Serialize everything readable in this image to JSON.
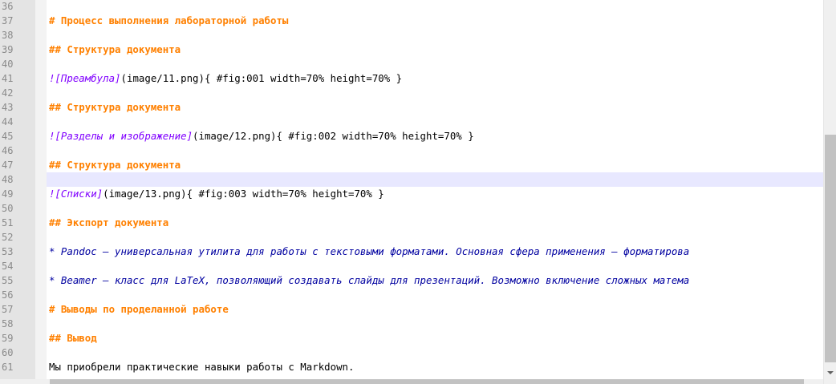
{
  "editor": {
    "lines": [
      {
        "num": "36",
        "segments": []
      },
      {
        "num": "37",
        "segments": [
          {
            "cls": "hdr",
            "text": "# Процесс выполнения лабораторной работы"
          }
        ]
      },
      {
        "num": "38",
        "segments": []
      },
      {
        "num": "39",
        "segments": [
          {
            "cls": "hdr",
            "text": "## Структура документа"
          }
        ]
      },
      {
        "num": "40",
        "segments": []
      },
      {
        "num": "41",
        "segments": [
          {
            "cls": "img-bang",
            "text": "![Преамбула]"
          },
          {
            "cls": "plain",
            "text": "(image/11.png){ #fig:001 width=70% height=70% }"
          }
        ]
      },
      {
        "num": "42",
        "segments": []
      },
      {
        "num": "43",
        "segments": [
          {
            "cls": "hdr",
            "text": "## Структура документа"
          }
        ]
      },
      {
        "num": "44",
        "segments": []
      },
      {
        "num": "45",
        "segments": [
          {
            "cls": "img-bang",
            "text": "![Разделы и изображение]"
          },
          {
            "cls": "plain",
            "text": "(image/12.png){ #fig:002 width=70% height=70% }"
          }
        ]
      },
      {
        "num": "46",
        "segments": []
      },
      {
        "num": "47",
        "segments": [
          {
            "cls": "hdr",
            "text": "## Структура документа"
          }
        ]
      },
      {
        "num": "48",
        "segments": [],
        "current": true
      },
      {
        "num": "49",
        "segments": [
          {
            "cls": "img-bang",
            "text": "![Списки]"
          },
          {
            "cls": "plain",
            "text": "(image/13.png){ #fig:003 width=70% height=70% }"
          }
        ]
      },
      {
        "num": "50",
        "segments": []
      },
      {
        "num": "51",
        "segments": [
          {
            "cls": "hdr",
            "text": "## Экспорт документа"
          }
        ]
      },
      {
        "num": "52",
        "segments": []
      },
      {
        "num": "53",
        "segments": [
          {
            "cls": "emph",
            "text": "* Pandoc — универсальная утилита для работы с текстовыми форматами. Основная сфера применения — форматирова"
          }
        ]
      },
      {
        "num": "54",
        "segments": []
      },
      {
        "num": "55",
        "segments": [
          {
            "cls": "emph",
            "text": "* Beamer — класс для LaTeX, позволяющий создавать слайды для презентаций. Возможно включение сложных матема"
          }
        ]
      },
      {
        "num": "56",
        "segments": []
      },
      {
        "num": "57",
        "segments": [
          {
            "cls": "hdr",
            "text": "# Выводы по проделанной работе"
          }
        ]
      },
      {
        "num": "58",
        "segments": []
      },
      {
        "num": "59",
        "segments": [
          {
            "cls": "hdr",
            "text": "## Вывод"
          }
        ]
      },
      {
        "num": "60",
        "segments": []
      },
      {
        "num": "61",
        "segments": [
          {
            "cls": "plain",
            "text": "Мы приобрели практические навыки работы с Markdown."
          }
        ]
      }
    ]
  },
  "colors": {
    "header": "#ff8000",
    "emphasis": "#0000a0",
    "image_link": "#8000ff",
    "current_line": "#e8e8ff",
    "gutter": "#e4e4e4"
  },
  "scrollbars": {
    "vertical_icon": "chevron-down-icon"
  }
}
